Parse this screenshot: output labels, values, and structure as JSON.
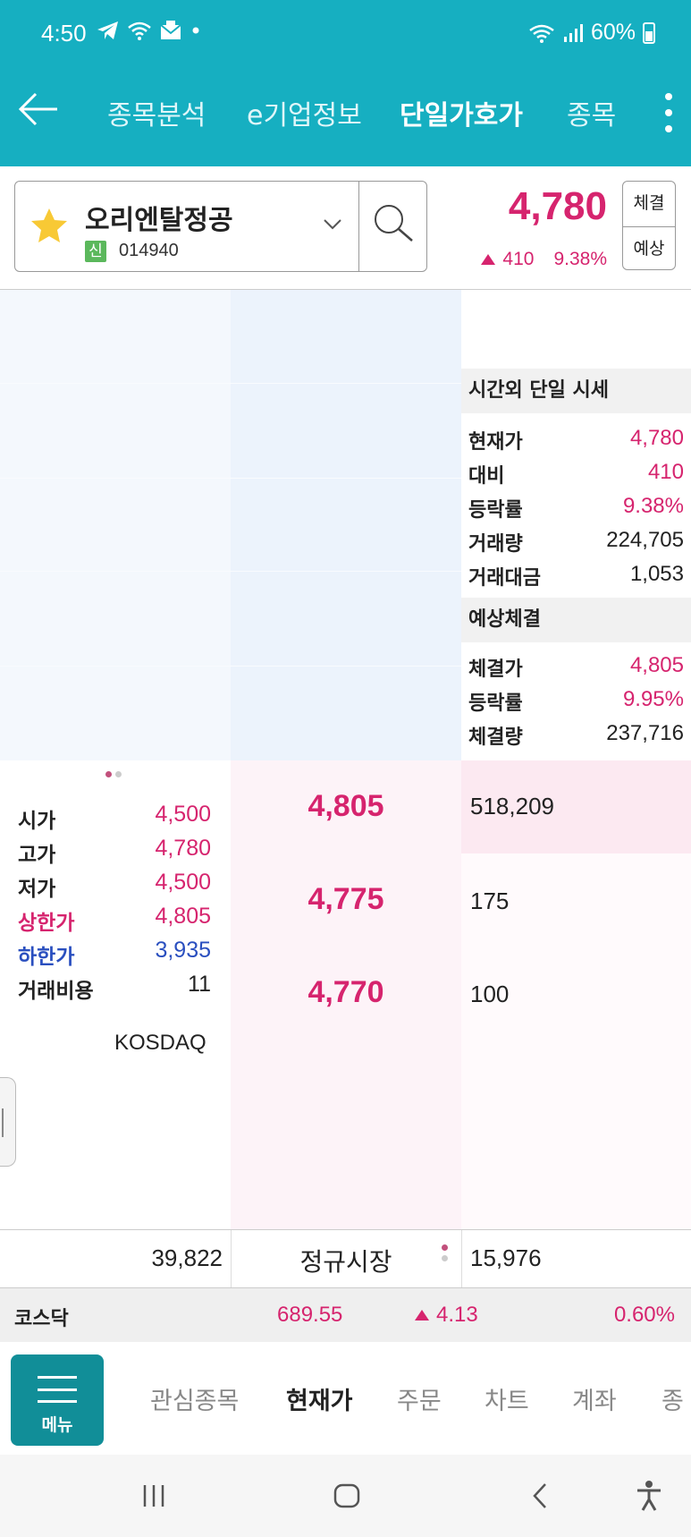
{
  "status_bar": {
    "time": "4:50",
    "battery": "60%"
  },
  "nav": {
    "tabs": [
      {
        "label": "종목분석"
      },
      {
        "label": "e기업정보"
      },
      {
        "label": "단일가호가"
      },
      {
        "label": "종목"
      }
    ]
  },
  "stock": {
    "name": "오리엔탈정공",
    "badge": "신",
    "code": "014940",
    "price": "4,780",
    "change": "410",
    "change_pct": "9.38%",
    "btn_trade": "체결",
    "btn_expected": "예상"
  },
  "after_hours": {
    "title": "시간외 단일 시세",
    "rows": [
      {
        "label": "현재가",
        "value": "4,780"
      },
      {
        "label": "대비",
        "value": "410"
      },
      {
        "label": "등락률",
        "value": "9.38%"
      },
      {
        "label": "거래량",
        "value": "224,705"
      },
      {
        "label": "거래대금",
        "value": "1,053"
      }
    ]
  },
  "expected": {
    "title": "예상체결",
    "rows": [
      {
        "label": "체결가",
        "value": "4,805"
      },
      {
        "label": "등락률",
        "value": "9.95%"
      },
      {
        "label": "체결량",
        "value": "237,716"
      }
    ]
  },
  "asks": [
    {
      "price": "4,805",
      "volume": "518,209"
    },
    {
      "price": "4,775",
      "volume": "175"
    },
    {
      "price": "4,770",
      "volume": "100"
    }
  ],
  "stats": {
    "rows": [
      {
        "label": "시가",
        "value": "4,500"
      },
      {
        "label": "고가",
        "value": "4,780"
      },
      {
        "label": "저가",
        "value": "4,500"
      },
      {
        "label": "상한가",
        "value": "4,805"
      },
      {
        "label": "하한가",
        "value": "3,935"
      },
      {
        "label": "거래비용",
        "value": "11"
      }
    ],
    "market": "KOSDAQ"
  },
  "totals": {
    "left": "39,822",
    "mid": "정규시장",
    "right": "15,976"
  },
  "index": {
    "name": "코스닥",
    "value": "689.55",
    "change": "4.13",
    "pct": "0.60%"
  },
  "tabbar": {
    "menu_label": "메뉴",
    "tabs": [
      {
        "label": "관심종목"
      },
      {
        "label": "현재가"
      },
      {
        "label": "주문"
      },
      {
        "label": "차트"
      },
      {
        "label": "계좌"
      },
      {
        "label": "종"
      }
    ]
  },
  "colors": {
    "header": "#16AFC1",
    "up": "#D6246E",
    "down": "#2A4FBF",
    "menu": "#118E98"
  },
  "icons": [
    "back-arrow-icon",
    "star-icon",
    "chevron-down-icon",
    "search-icon",
    "kebab-menu-icon",
    "up-triangle-icon",
    "hamburger-icon"
  ]
}
